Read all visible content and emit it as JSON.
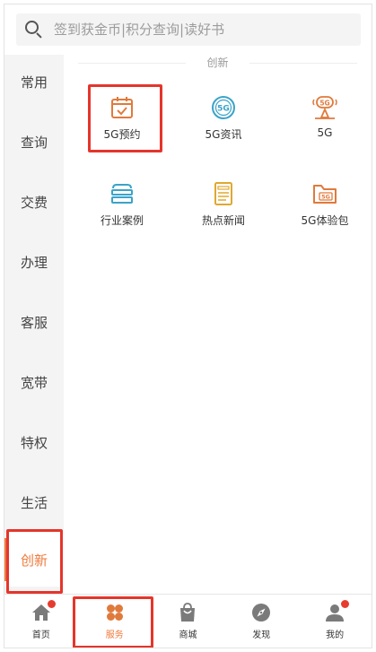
{
  "search": {
    "placeholder": "签到获金币|积分查询|读好书"
  },
  "sidebar": {
    "items": [
      {
        "label": "常用"
      },
      {
        "label": "查询"
      },
      {
        "label": "交费"
      },
      {
        "label": "办理"
      },
      {
        "label": "客服"
      },
      {
        "label": "宽带"
      },
      {
        "label": "特权"
      },
      {
        "label": "生活"
      },
      {
        "label": "创新",
        "active": true
      }
    ]
  },
  "content": {
    "section_title": "创新",
    "items": [
      {
        "label": "5G预约",
        "icon": "calendar-check-icon"
      },
      {
        "label": "5G资讯",
        "icon": "5g-badge-icon"
      },
      {
        "label": "5G",
        "icon": "5g-signal-icon"
      },
      {
        "label": "行业案例",
        "icon": "layers-icon"
      },
      {
        "label": "热点新闻",
        "icon": "newspaper-icon"
      },
      {
        "label": "5G体验包",
        "icon": "5g-folder-icon"
      }
    ]
  },
  "tabbar": {
    "tabs": [
      {
        "label": "首页",
        "icon": "home-icon",
        "badge": true
      },
      {
        "label": "服务",
        "icon": "services-icon",
        "active": true
      },
      {
        "label": "商城",
        "icon": "shopping-bag-icon"
      },
      {
        "label": "发现",
        "icon": "compass-icon"
      },
      {
        "label": "我的",
        "icon": "user-icon",
        "badge": true
      }
    ]
  },
  "colors": {
    "accent": "#f07a3c",
    "highlight": "#e5352b",
    "badge": "#e63c2f",
    "teal": "#3ba3c8",
    "gold": "#e0a830"
  }
}
